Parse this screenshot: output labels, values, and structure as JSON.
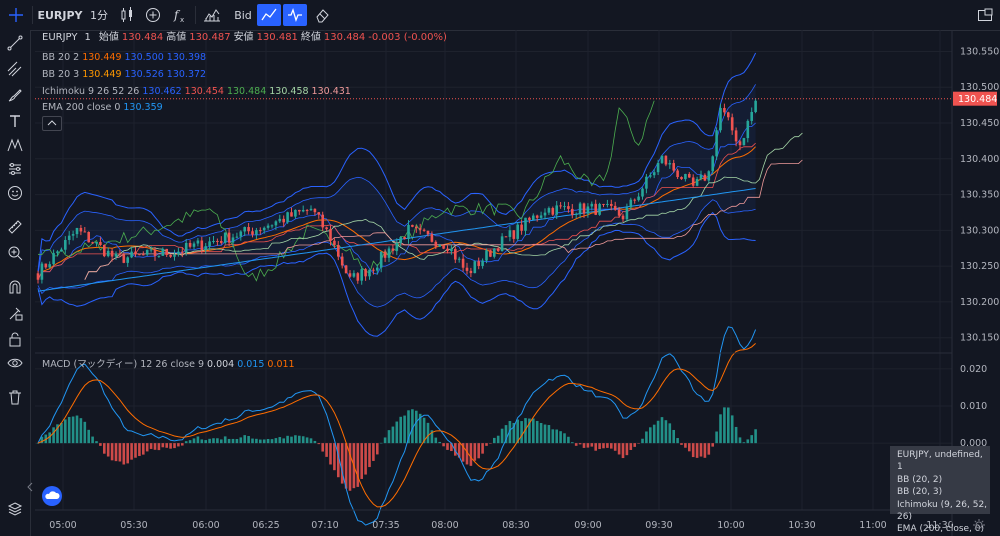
{
  "toolbar": {
    "symbol": "EURJPY",
    "interval": "1分",
    "price_type": "Bid"
  },
  "legend": {
    "main": {
      "symbol": "EURJPY",
      "interval": "1",
      "open_label": "始値",
      "open": "130.484",
      "high_label": "高値",
      "high": "130.487",
      "low_label": "安値",
      "low": "130.481",
      "close_label": "終値",
      "close": "130.484",
      "change": "-0.003 (-0.00%)"
    },
    "bb1": {
      "name": "BB",
      "params": "20 2",
      "v1": "130.449",
      "v2": "130.500",
      "v3": "130.398"
    },
    "bb2": {
      "name": "BB",
      "params": "20 3",
      "v1": "130.449",
      "v2": "130.526",
      "v3": "130.372"
    },
    "ichimoku": {
      "name": "Ichimoku",
      "params": "9 26 52 26",
      "v1": "130.462",
      "v2": "130.454",
      "v3": "130.484",
      "v4": "130.458",
      "v5": "130.431"
    },
    "ema": {
      "name": "EMA",
      "params": "200 close 0",
      "v1": "130.359"
    },
    "macd": {
      "name": "MACD (マックディー)",
      "params": "12 26 close 9",
      "v1": "0.004",
      "v2": "0.015",
      "v3": "0.011"
    }
  },
  "price_axis": {
    "labels": [
      "130.550",
      "130.500",
      "130.450",
      "130.400",
      "130.350",
      "130.300",
      "130.250",
      "130.200",
      "130.150"
    ],
    "current": "130.484"
  },
  "macd_axis": {
    "labels": [
      "0.020",
      "0.010",
      "0.000"
    ]
  },
  "time_axis": {
    "labels": [
      "05:00",
      "05:30",
      "06:00",
      "06:25",
      "07:10",
      "07:35",
      "08:00",
      "08:30",
      "09:00",
      "09:30",
      "10:00",
      "10:30",
      "11:00",
      "11:30"
    ]
  },
  "tooltip": {
    "lines": [
      "EURJPY, undefined, 1",
      "BB (20, 2)",
      "BB (20, 3)",
      "Ichimoku (9, 26, 52, 26)",
      "EMA (200, close, 0)"
    ]
  },
  "colors": {
    "background": "#131722",
    "up": "#26a69a",
    "down": "#ef5350",
    "accent": "#2962ff",
    "bb_upper": "#2962ff",
    "orange": "#ff6d00"
  },
  "chart_data": {
    "type": "candlestick",
    "ylim": [
      130.13,
      130.58
    ],
    "note": "EURJPY 1-minute candles with Bollinger Bands, Ichimoku and EMA overlays; MACD sub-panel",
    "macd_ylim": [
      -0.018,
      0.024
    ]
  }
}
